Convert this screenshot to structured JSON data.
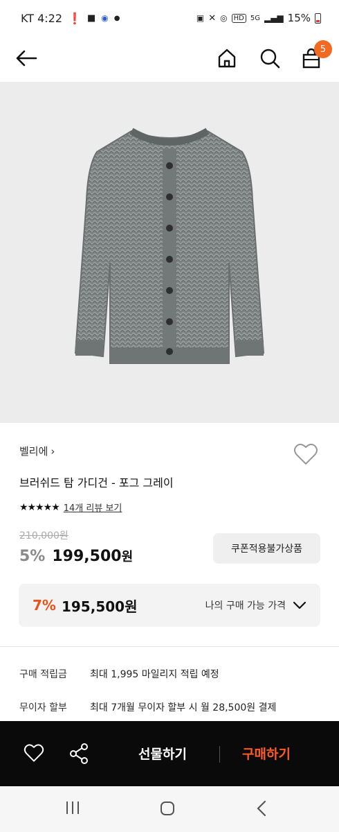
{
  "status": {
    "carrier_time": "KT 4:22",
    "battery": "15%"
  },
  "header": {
    "cart_count": "5"
  },
  "product": {
    "brand": "벨리에",
    "name": "브러쉬드 탐 가디건 - 포그 그레이",
    "review_text": "14개 리뷰 보기",
    "stars": "★★★★★",
    "original_price": "210,000원",
    "discount_percent": "5%",
    "price_amount": "199,500",
    "price_unit": "원",
    "coupon_label": "쿠폰적용불가상품",
    "my_discount_percent": "7%",
    "my_price": "195,500원",
    "my_price_label": "나의 구매 가능 가격"
  },
  "details": [
    {
      "key": "구매 적립금",
      "value": "최대 1,995 마일리지 적립 예정"
    },
    {
      "key": "무이자 할부",
      "value": "최대 7개월 무이자 할부 시 월 28,500원 결제"
    }
  ],
  "bottom_bar": {
    "gift_label": "선물하기",
    "buy_label": "구매하기"
  },
  "colors": {
    "accent": "#ff5a1f",
    "badge": "#f26a21"
  }
}
